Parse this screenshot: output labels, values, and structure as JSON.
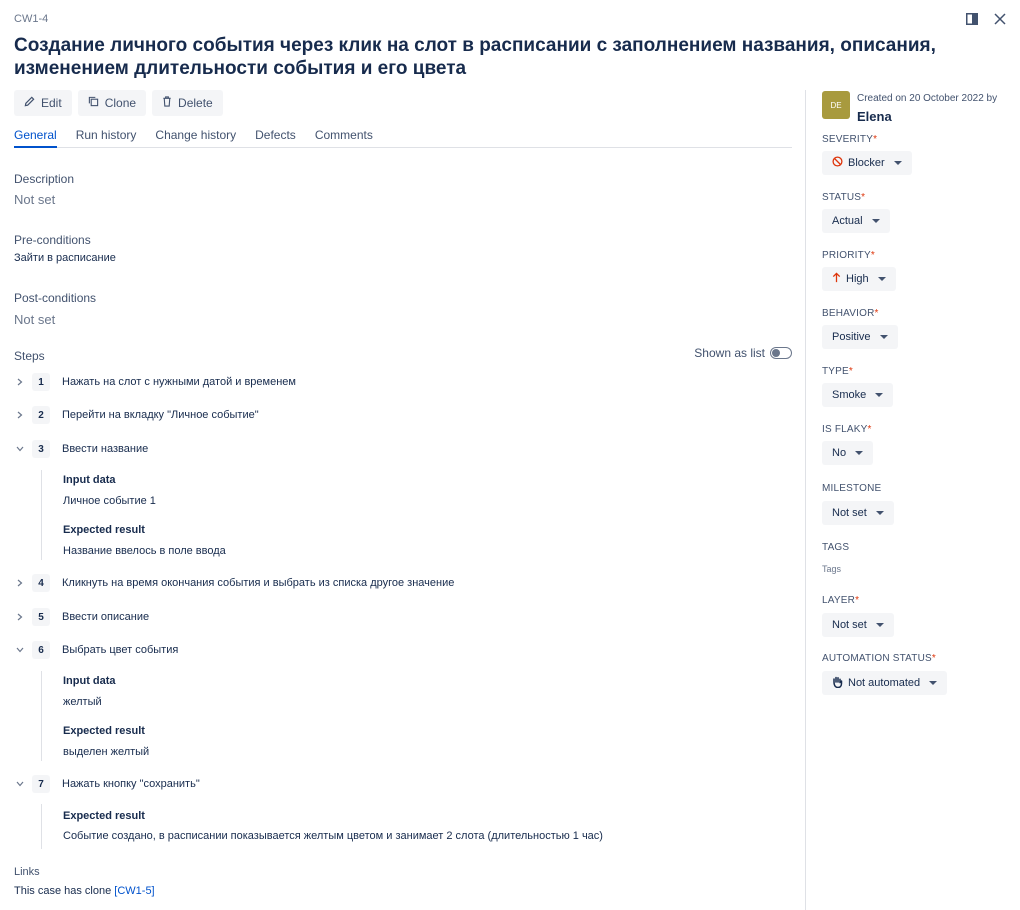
{
  "case_key": "CW1-4",
  "title": "Создание личного события через клик на слот в расписании с заполнением названия, описания, изменением длительности события и его цвета",
  "toolbar": {
    "edit": "Edit",
    "clone": "Clone",
    "delete": "Delete"
  },
  "tabs": [
    "General",
    "Run history",
    "Change history",
    "Defects",
    "Comments"
  ],
  "description": {
    "label": "Description",
    "value": "Not set"
  },
  "preconditions": {
    "label": "Pre-conditions",
    "value": "Зайти в расписание"
  },
  "postconditions": {
    "label": "Post-conditions",
    "value": "Not set"
  },
  "steps": {
    "label": "Steps",
    "toggle_label": "Shown as list",
    "items": [
      {
        "num": "1",
        "text": "Нажать на слот с нужными датой и временем",
        "expanded": false
      },
      {
        "num": "2",
        "text": "Перейти на вкладку \"Личное событие\"",
        "expanded": false
      },
      {
        "num": "3",
        "text": "Ввести название",
        "expanded": true,
        "input_label": "Input data",
        "input_value": "Личное событие 1",
        "expected_label": "Expected result",
        "expected_value": "Название ввелось в поле ввода"
      },
      {
        "num": "4",
        "text": "Кликнуть на время окончания события и выбрать из списка другое значение",
        "expanded": false
      },
      {
        "num": "5",
        "text": "Ввести описание",
        "expanded": false
      },
      {
        "num": "6",
        "text": "Выбрать цвет события",
        "expanded": true,
        "input_label": "Input data",
        "input_value": "желтый",
        "expected_label": "Expected result",
        "expected_value": "выделен желтый"
      },
      {
        "num": "7",
        "text": "Нажать кнопку \"сохранить\"",
        "expanded": true,
        "expected_label": "Expected result",
        "expected_value": "Событие создано, в расписании показывается желтым цветом и занимает 2 слота (длительностью 1 час)"
      }
    ]
  },
  "links": {
    "label": "Links",
    "text": "This case has clone ",
    "link": "[CW1-5]"
  },
  "sidebar": {
    "avatar": "DE",
    "created": "Created on 20 October 2022 by",
    "author": "Elena",
    "fields": {
      "severity": {
        "label": "SEVERITY",
        "value": "Blocker",
        "required": "*"
      },
      "status": {
        "label": "STATUS",
        "value": "Actual",
        "required": "*"
      },
      "priority": {
        "label": "PRIORITY",
        "value": "High",
        "required": "*"
      },
      "behavior": {
        "label": "BEHAVIOR",
        "value": "Positive",
        "required": "*"
      },
      "type": {
        "label": "TYPE",
        "value": "Smoke",
        "required": "*"
      },
      "is_flaky": {
        "label": "IS FLAKY",
        "value": "No",
        "required": "*"
      },
      "milestone": {
        "label": "MILESTONE",
        "value": "Not set"
      },
      "tags": {
        "label": "TAGS",
        "placeholder": "Tags"
      },
      "layer": {
        "label": "LAYER",
        "value": "Not set",
        "required": "*"
      },
      "automation_status": {
        "label": "AUTOMATION STATUS",
        "value": "Not automated",
        "required": "*"
      }
    }
  },
  "colors": {
    "accent": "#0052cc",
    "danger": "#de350b",
    "avatar": "#a89a3e"
  },
  "icons": [
    "sidebar-toggle-icon",
    "close-icon",
    "pencil-icon",
    "copy-icon",
    "trash-icon",
    "chevron-right-icon",
    "chevron-down-icon",
    "blocker-icon",
    "arrow-up-icon",
    "hand-icon"
  ]
}
